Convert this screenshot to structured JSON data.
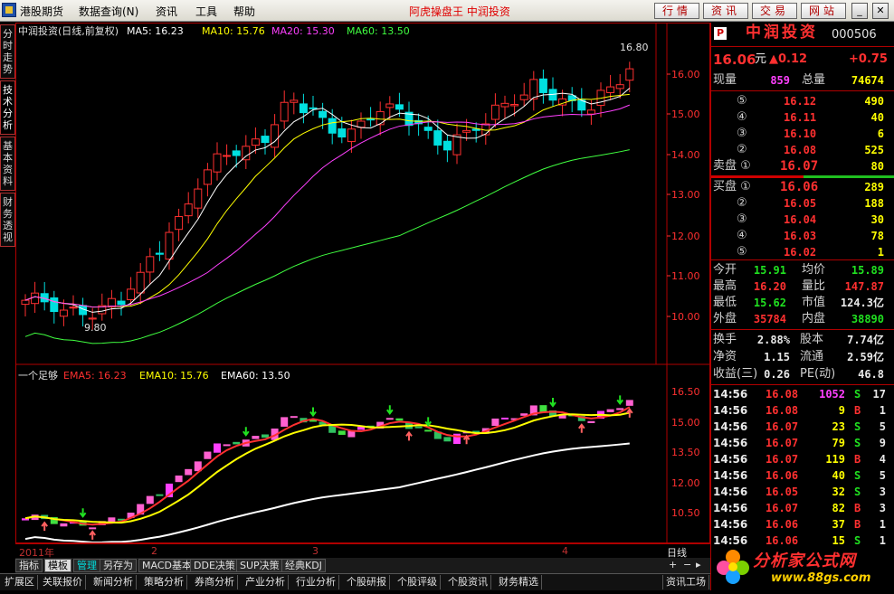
{
  "menu": [
    "港股期货",
    "数据查询(N)",
    "资讯",
    "工具",
    "帮助"
  ],
  "app_title": "阿虎操盘王  中润投资",
  "top_buttons": [
    "行情",
    "资讯",
    "交易",
    "网站"
  ],
  "left_tabs": [
    "分时走势",
    "技术分析",
    "基本资料",
    "财务透视"
  ],
  "main_chart": {
    "title": "中润投资(日线,前复权)",
    "legend": [
      {
        "label": "MA5: 16.23",
        "color": "#ffffff"
      },
      {
        "label": "MA10: 15.76",
        "color": "#ffff00"
      },
      {
        "label": "MA20: 15.30",
        "color": "#ff40ff"
      },
      {
        "label": "MA60: 13.50",
        "color": "#40ff40"
      }
    ],
    "y_ticks": [
      "16.00",
      "15.00",
      "14.00",
      "13.00",
      "12.00",
      "11.00",
      "10.00"
    ],
    "high_label": "16.80",
    "low_label": "9.80"
  },
  "sub_chart": {
    "title": "一个足够",
    "legend": [
      {
        "label": "EMA5: 16.23",
        "color": "#ff3030"
      },
      {
        "label": "EMA10: 15.76",
        "color": "#ffff00"
      },
      {
        "label": "EMA60: 13.50",
        "color": "#ffffff"
      }
    ],
    "y_ticks": [
      "16.50",
      "15.00",
      "13.50",
      "12.00",
      "10.50"
    ]
  },
  "time_axis": [
    "2011年",
    "2",
    "3",
    "4"
  ],
  "period": "日线",
  "tabs_row1": [
    "指标",
    "模板",
    "管理",
    "另存为",
    "MACD基本",
    "DDE决策",
    "SUP决策",
    "经典KDJ"
  ],
  "tabs_row2": [
    "扩展区",
    "关联报价",
    "新闻分析",
    "策略分析",
    "券商分析",
    "产业分析",
    "行业分析",
    "个股研报",
    "个股评级",
    "个股资讯",
    "财务精选"
  ],
  "tabs_row2_right": "资讯工场",
  "quote": {
    "badge": "P",
    "name": "中润投资",
    "code": "000506",
    "price": "16.06",
    "unit": "元",
    "change": "▲0.12",
    "pct": "+0.75",
    "xianliang_label": "现量",
    "xianliang": "859",
    "zongliang_label": "总量",
    "zongliang": "74674",
    "sell": [
      {
        "lvl": "⑤",
        "price": "16.12",
        "vol": "490"
      },
      {
        "lvl": "④",
        "price": "16.11",
        "vol": "40"
      },
      {
        "lvl": "③",
        "price": "16.10",
        "vol": "6"
      },
      {
        "lvl": "②",
        "price": "16.08",
        "vol": "525"
      }
    ],
    "sell1_label": "卖盘 ①",
    "sell1_price": "16.07",
    "sell1_vol": "80",
    "buy1_label": "买盘 ①",
    "buy1_price": "16.06",
    "buy1_vol": "289",
    "buy": [
      {
        "lvl": "②",
        "price": "16.05",
        "vol": "188"
      },
      {
        "lvl": "③",
        "price": "16.04",
        "vol": "30"
      },
      {
        "lvl": "④",
        "price": "16.03",
        "vol": "78"
      },
      {
        "lvl": "⑤",
        "price": "16.02",
        "vol": "1"
      }
    ],
    "stats": [
      {
        "l1": "今开",
        "v1": "15.91",
        "c1": "g",
        "l2": "均价",
        "v2": "15.89",
        "c2": "g"
      },
      {
        "l1": "最高",
        "v1": "16.20",
        "c1": "r",
        "l2": "量比",
        "v2": "147.87",
        "c2": "r"
      },
      {
        "l1": "最低",
        "v1": "15.62",
        "c1": "g",
        "l2": "市值",
        "v2": "124.3亿",
        "c2": "w"
      },
      {
        "l1": "外盘",
        "v1": "35784",
        "c1": "r",
        "l2": "内盘",
        "v2": "38890",
        "c2": "g"
      }
    ],
    "stats2": [
      {
        "l1": "换手",
        "v1": "2.88%",
        "l2": "股本",
        "v2": "7.74亿"
      },
      {
        "l1": "净资",
        "v1": "1.15",
        "l2": "流通",
        "v2": "2.59亿"
      },
      {
        "l1": "收益(三)",
        "v1": "0.26",
        "l2": "PE(动)",
        "v2": "46.8"
      }
    ],
    "ticks": [
      {
        "t": "14:56",
        "p": "16.08",
        "v": "1052",
        "s": "S",
        "n": "17"
      },
      {
        "t": "14:56",
        "p": "16.08",
        "v": "9",
        "s": "B",
        "n": "1"
      },
      {
        "t": "14:56",
        "p": "16.07",
        "v": "23",
        "s": "S",
        "n": "5"
      },
      {
        "t": "14:56",
        "p": "16.07",
        "v": "79",
        "s": "S",
        "n": "9"
      },
      {
        "t": "14:56",
        "p": "16.07",
        "v": "119",
        "s": "B",
        "n": "4"
      },
      {
        "t": "14:56",
        "p": "16.06",
        "v": "40",
        "s": "S",
        "n": "5"
      },
      {
        "t": "14:56",
        "p": "16.05",
        "v": "32",
        "s": "S",
        "n": "3"
      },
      {
        "t": "14:56",
        "p": "16.07",
        "v": "82",
        "s": "B",
        "n": "3"
      },
      {
        "t": "14:56",
        "p": "16.06",
        "v": "37",
        "s": "B",
        "n": "1"
      },
      {
        "t": "14:56",
        "p": "16.06",
        "v": "15",
        "s": "S",
        "n": "1"
      }
    ]
  },
  "watermark": {
    "main": "分析家公式网",
    "sub": "www.88gs.com"
  }
}
